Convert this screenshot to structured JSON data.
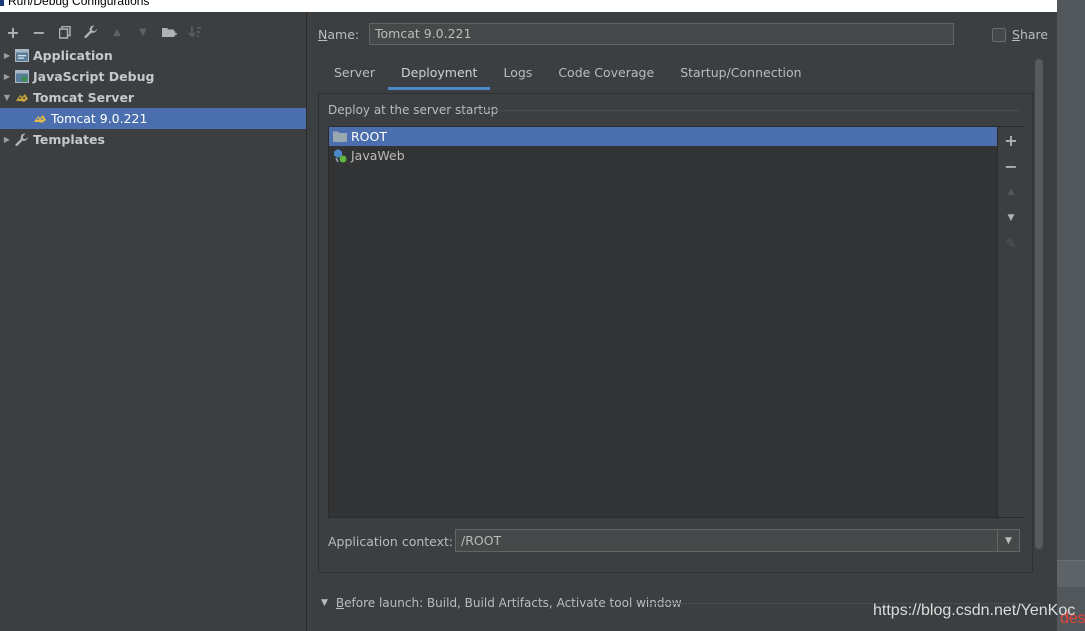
{
  "window": {
    "title": "Run/Debug Configurations"
  },
  "toolbar": {
    "add": "+",
    "remove": "−",
    "copy": "⧉",
    "wrench": "🔧",
    "up": "▲",
    "down": "▼",
    "folder": "folder-plus",
    "sort": "↓"
  },
  "tree": {
    "items": [
      {
        "label": "Application",
        "icon": "application-icon"
      },
      {
        "label": "JavaScript Debug",
        "icon": "javascript-debug-icon"
      },
      {
        "label": "Tomcat Server",
        "icon": "tomcat-icon"
      },
      {
        "label": "Tomcat 9.0.221",
        "icon": "tomcat-icon"
      },
      {
        "label": "Templates",
        "icon": "wrench-icon"
      }
    ]
  },
  "form": {
    "name_label_pre": "N",
    "name_label_post": "ame:",
    "name_value": "Tomcat 9.0.221",
    "share_pre": "S",
    "share_post": "hare"
  },
  "tabs": [
    "Server",
    "Deployment",
    "Logs",
    "Code Coverage",
    "Startup/Connection"
  ],
  "deployment": {
    "header": "Deploy at the server startup",
    "items": [
      {
        "label": "ROOT",
        "icon": "folder-icon"
      },
      {
        "label": "JavaWeb",
        "icon": "artifact-icon"
      }
    ],
    "tools": {
      "add": "+",
      "remove": "−",
      "up": "▲",
      "down": "▼",
      "edit": "✎"
    },
    "context_label": "Application context:",
    "context_value": "/ROOT"
  },
  "before_launch": {
    "pre": "B",
    "post": "efore launch: Build, Build Artifacts, Activate tool window"
  },
  "watermark": "https://blog.csdn.net/YenKoc",
  "backdrop_text": "des",
  "colors": {
    "selection": "#4b6eaf",
    "tab_underline": "#4a88c7",
    "background": "#3c3f41"
  }
}
